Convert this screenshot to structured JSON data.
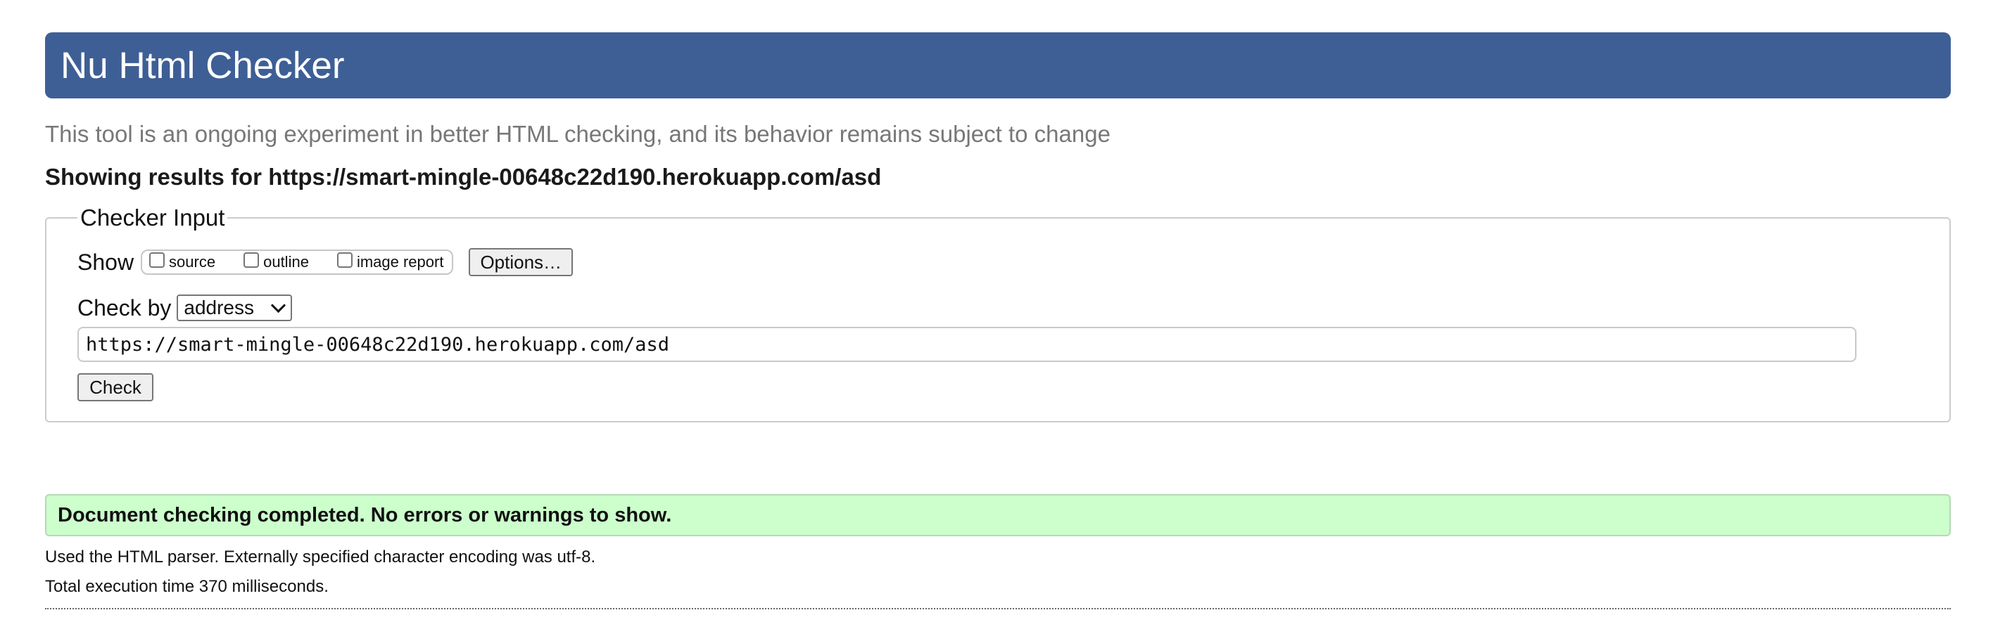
{
  "header": {
    "title": "Nu Html Checker"
  },
  "intro": "This tool is an ongoing experiment in better HTML checking, and its behavior remains subject to change",
  "results_heading": "Showing results for https://smart-mingle-00648c22d190.herokuapp.com/asd",
  "checker": {
    "legend": "Checker Input",
    "show_label": "Show",
    "checkboxes": [
      {
        "label": "source",
        "checked": false
      },
      {
        "label": "outline",
        "checked": false
      },
      {
        "label": "image report",
        "checked": false
      }
    ],
    "options_label": "Options…",
    "check_by_label": "Check by",
    "check_by_value": "address",
    "url_value": "https://smart-mingle-00648c22d190.herokuapp.com/asd",
    "check_label": "Check"
  },
  "result": {
    "status": "Document checking completed. No errors or warnings to show.",
    "parser_note": "Used the HTML parser. Externally specified character encoding was utf-8.",
    "time_note": "Total execution time 370 milliseconds."
  },
  "colors": {
    "header_bg": "#3e5f96",
    "success_bg": "#ccffcc"
  }
}
